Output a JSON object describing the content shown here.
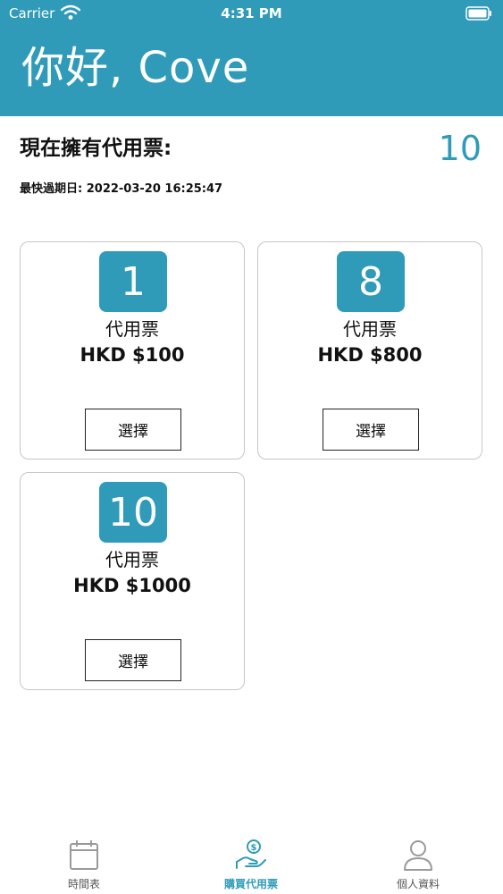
{
  "status_bar": {
    "carrier": "Carrier",
    "time": "4:31 PM"
  },
  "header": {
    "greeting": "你好, Cove"
  },
  "summary": {
    "label": "現在擁有代用票:",
    "count": "10",
    "expiry": "最快過期日: 2022-03-20 16:25:47"
  },
  "packages": [
    {
      "quantity": "1",
      "label": "代用票",
      "price": "HKD $100",
      "button": "選擇"
    },
    {
      "quantity": "8",
      "label": "代用票",
      "price": "HKD $800",
      "button": "選擇"
    },
    {
      "quantity": "10",
      "label": "代用票",
      "price": "HKD $1000",
      "button": "選擇"
    }
  ],
  "tabs": [
    {
      "label": "時間表",
      "icon": "calendar-icon"
    },
    {
      "label": "購買代用票",
      "icon": "coin-hand-icon"
    },
    {
      "label": "個人資料",
      "icon": "person-icon"
    }
  ],
  "colors": {
    "accent": "#2f9bb9",
    "tab_inactive": "#9a9a9a"
  }
}
